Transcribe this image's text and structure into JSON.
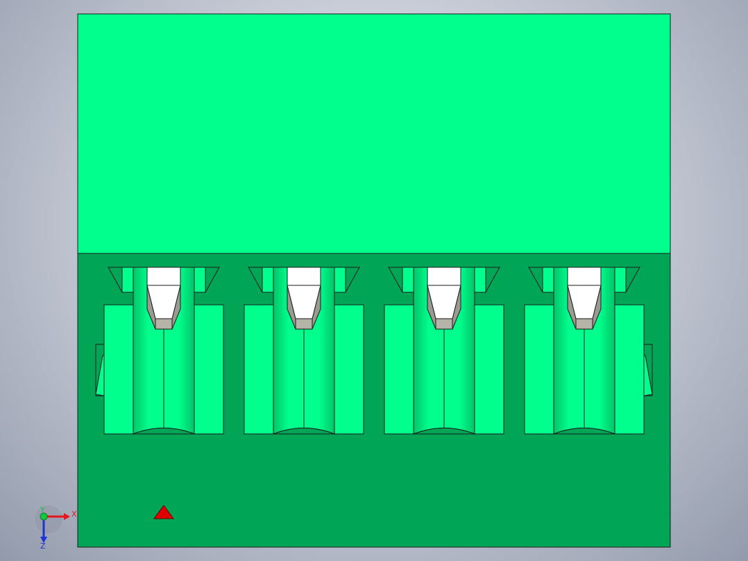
{
  "viewport": {
    "view": "front"
  },
  "model": {
    "connector_count": 4
  },
  "colors": {
    "background_center": "#e4e8ee",
    "background_edge": "#939aab",
    "body_light": "#00ff8c",
    "body_dark": "#00a555",
    "edge": "#1a1a1a",
    "pin_white": "#ffffff",
    "pin_gray": "#b4b4a8",
    "pin_shadow": "#8a8a80",
    "origin_marker": "#dd0000"
  },
  "triad": {
    "x_label": "X",
    "y_label": "Y",
    "z_label": "Z",
    "x_color": "#e8141c",
    "y_color": "#12c83c",
    "z_color": "#1a33d6"
  }
}
